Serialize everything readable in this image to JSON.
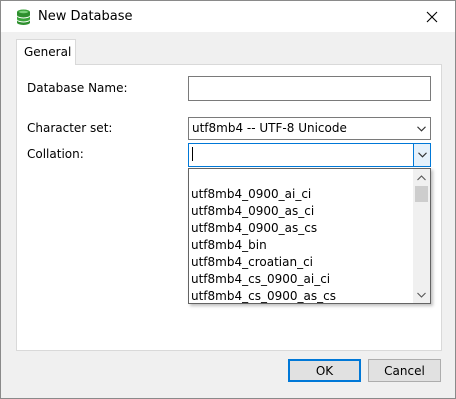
{
  "window": {
    "title": "New Database",
    "icon": "database-icon"
  },
  "tabs": [
    {
      "label": "General",
      "active": true
    }
  ],
  "form": {
    "database_name_label": "Database Name:",
    "database_name_value": "",
    "character_set_label": "Character set:",
    "character_set_value": "utf8mb4 -- UTF-8 Unicode",
    "collation_label": "Collation:",
    "collation_value": ""
  },
  "collation_dropdown": {
    "items": [
      "",
      "utf8mb4_0900_ai_ci",
      "utf8mb4_0900_as_ci",
      "utf8mb4_0900_as_cs",
      "utf8mb4_bin",
      "utf8mb4_croatian_ci",
      "utf8mb4_cs_0900_ai_ci",
      "utf8mb4_cs_0900_as_cs"
    ]
  },
  "buttons": {
    "ok_label": "OK",
    "cancel_label": "Cancel"
  },
  "colors": {
    "accent": "#0078d7",
    "icon_green": "#3aa43a"
  }
}
